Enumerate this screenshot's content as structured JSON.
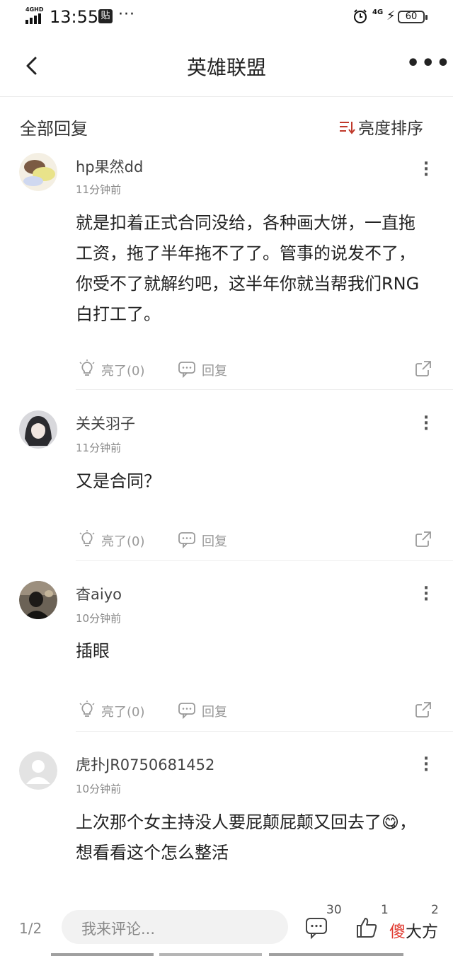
{
  "status_bar": {
    "network_label": "4GHD",
    "time": "13:55",
    "tie_badge": "贴",
    "dots": "···",
    "mobile_data": "4G",
    "battery": "60",
    "icons": [
      "signal-icon",
      "tieba-icon",
      "alarm-icon",
      "data-icon",
      "charging-icon",
      "battery-icon"
    ]
  },
  "nav": {
    "title": "英雄联盟",
    "more": "•••",
    "icons": [
      "back-arrow-icon",
      "more-icon"
    ]
  },
  "section": {
    "title": "全部回复",
    "sort_label": "亮度排序"
  },
  "comments": [
    {
      "username": "hp果然dd",
      "time": "11分钟前",
      "content": "就是扣着正式合同没给，各种画大饼，一直拖工资，拖了半年拖不了了。管事的说发不了，你受不了就解约吧，这半年你就当帮我们RNG白打工了。",
      "like_label": "亮了(0)",
      "reply_label": "回复"
    },
    {
      "username": "关关羽子",
      "time": "11分钟前",
      "content": "又是合同？",
      "like_label": "亮了(0)",
      "reply_label": "回复"
    },
    {
      "username": "杳aiyo",
      "time": "10分钟前",
      "content": "插眼",
      "like_label": "亮了(0)",
      "reply_label": "回复"
    },
    {
      "username": "虎扑JR0750681452",
      "time": "10分钟前",
      "content_before_emoji": "上次那个女主持没人要屁颠屁颠又回去了",
      "content_after_emoji": "，想看看这个怎么整活",
      "emoji": "😋"
    }
  ],
  "bottom_bar": {
    "page_indicator": "1/2",
    "comment_placeholder": "我来评论...",
    "comment_count": "30",
    "like_count": "1",
    "share_count": "2",
    "watermark_red": "傻",
    "watermark_black": "大方"
  },
  "colors": {
    "accent_red": "#e0392f",
    "text_primary": "#222222",
    "text_secondary": "#888888",
    "divider": "#eeeeee",
    "input_bg": "#f2f2f2"
  }
}
